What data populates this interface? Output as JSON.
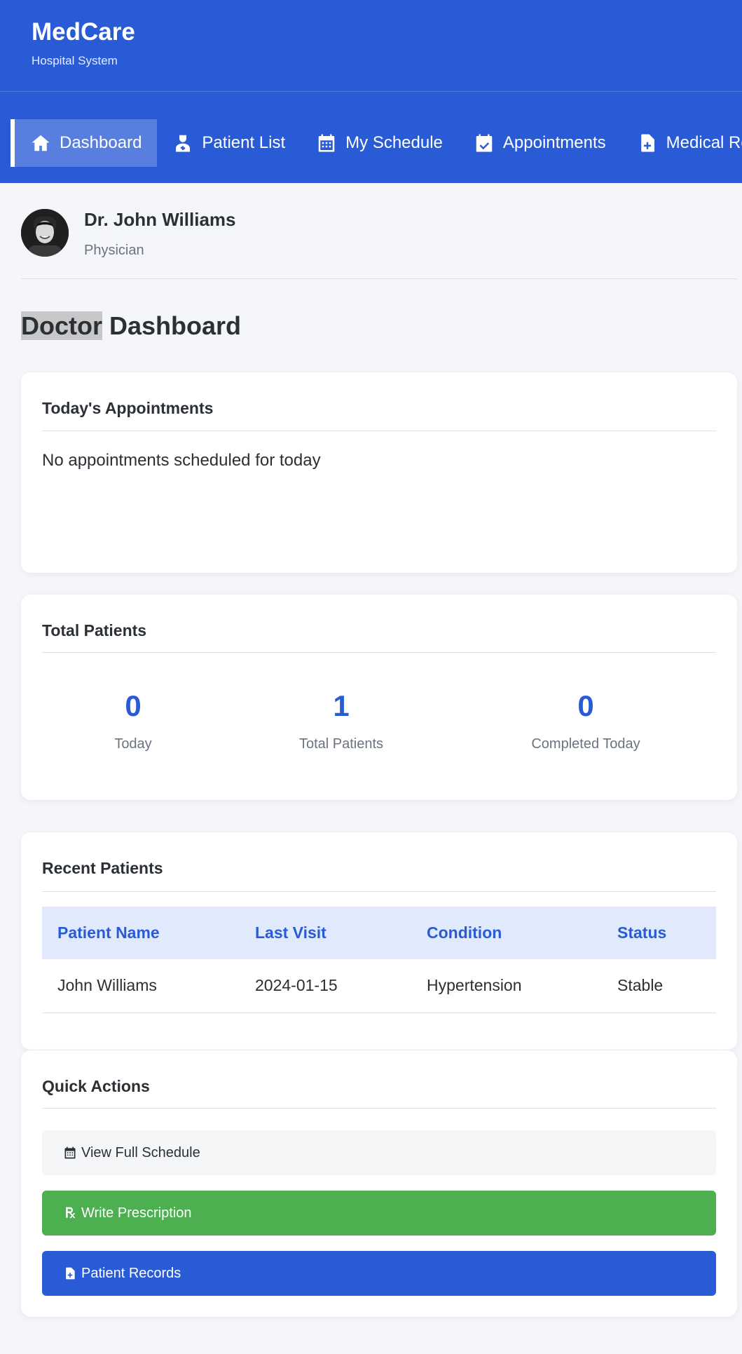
{
  "brand": {
    "name": "MedCare",
    "subtitle": "Hospital System"
  },
  "nav": {
    "items": [
      {
        "label": "Dashboard",
        "icon": "home-icon",
        "active": true
      },
      {
        "label": "Patient List",
        "icon": "user-doctor-icon",
        "active": false
      },
      {
        "label": "My Schedule",
        "icon": "calendar-icon",
        "active": false
      },
      {
        "label": "Appointments",
        "icon": "calendar-check-icon",
        "active": false
      },
      {
        "label": "Medical Records",
        "icon": "file-medical-icon",
        "active": false
      }
    ]
  },
  "profile": {
    "name": "Dr. John Williams",
    "role": "Physician"
  },
  "page": {
    "title_highlight": "Doctor",
    "title_rest": " Dashboard"
  },
  "appointments": {
    "title": "Today's Appointments",
    "empty_message": "No appointments scheduled for today"
  },
  "stats": {
    "title": "Total Patients",
    "items": [
      {
        "value": "0",
        "label": "Today"
      },
      {
        "value": "1",
        "label": "Total Patients"
      },
      {
        "value": "0",
        "label": "Completed Today"
      }
    ]
  },
  "recent": {
    "title": "Recent Patients",
    "headers": [
      "Patient Name",
      "Last Visit",
      "Condition",
      "Status"
    ],
    "rows": [
      [
        "John Williams",
        "2024-01-15",
        "Hypertension",
        "Stable"
      ]
    ]
  },
  "quick_actions": {
    "title": "Quick Actions",
    "items": [
      {
        "label": "View Full Schedule",
        "icon": "calendar-icon"
      },
      {
        "label": "Write Prescription",
        "icon": "prescription-icon"
      },
      {
        "label": "Patient Records",
        "icon": "file-medical-icon"
      }
    ]
  },
  "colors": {
    "primary": "#2a5bd7",
    "success": "#4caf50",
    "background": "#f4f6f9",
    "table_header": "#e1e9fd"
  }
}
